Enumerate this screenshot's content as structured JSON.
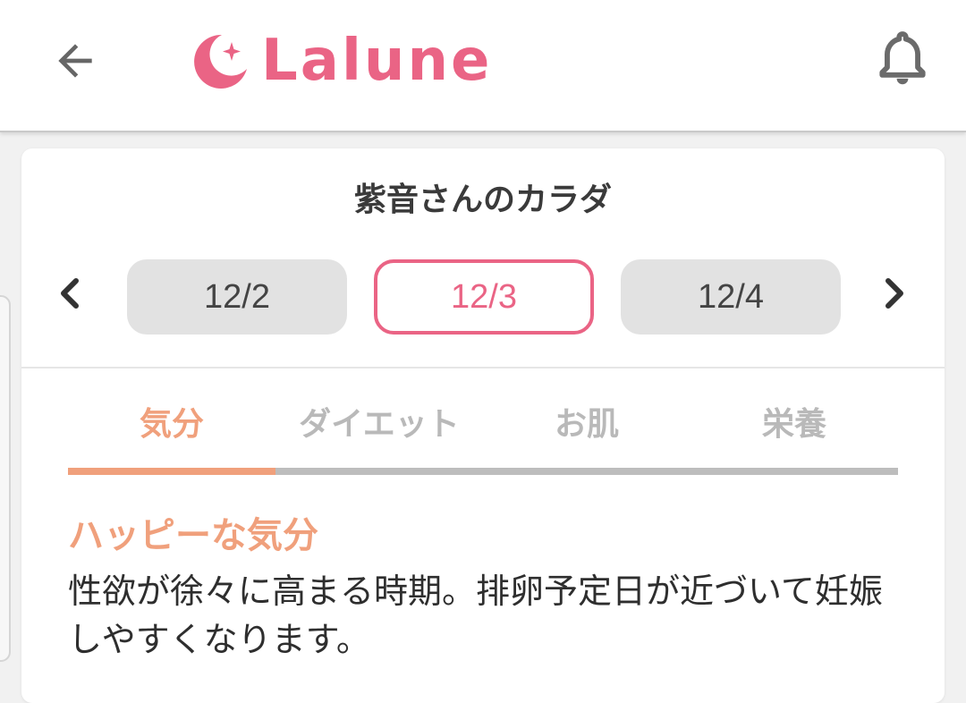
{
  "header": {
    "logo_text": "Lalune",
    "brand_color": "#ea6485",
    "icons": {
      "back": "arrow-left-icon",
      "logo": "crescent-moon-sparkle-icon",
      "notifications": "bell-icon"
    }
  },
  "card": {
    "title": "紫音さんのカラダ",
    "date_nav": {
      "prev_icon": "chevron-left-icon",
      "next_icon": "chevron-right-icon",
      "dates": [
        "12/2",
        "12/3",
        "12/4"
      ],
      "selected": "12/3"
    },
    "tabs": [
      {
        "label": "気分",
        "active": true
      },
      {
        "label": "ダイエット",
        "active": false
      },
      {
        "label": "お肌",
        "active": false
      },
      {
        "label": "栄養",
        "active": false
      }
    ],
    "accent_color": "#f0a07c",
    "content": {
      "title": "ハッピーな気分",
      "description": "性欲が徐々に高まる時期。排卵予定日が近づいて妊娠しやすくなります。"
    }
  }
}
